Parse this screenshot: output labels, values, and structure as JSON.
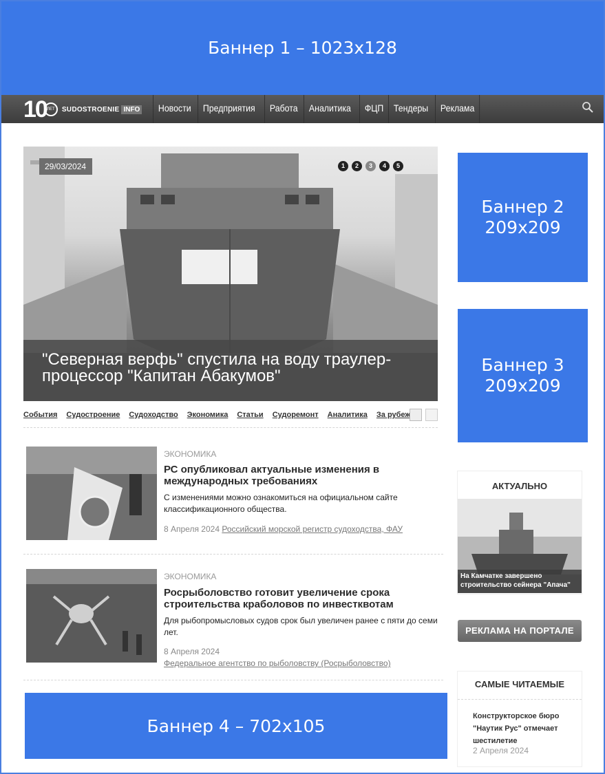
{
  "banners": {
    "b1": "Баннер 1 – 1023x128",
    "b2_line1": "Баннер 2",
    "b2_line2": "209x209",
    "b3_line1": "Баннер 3",
    "b3_line2": "209x209",
    "b4": "Баннер 4 – 702x105"
  },
  "logo": {
    "ten": "10",
    "let": "ЛЕТ",
    "name": "SUDOSTROENIE",
    "info": "INFO"
  },
  "nav": {
    "items": [
      "Новости",
      "Предприятия",
      "Работа",
      "Аналитика",
      "ФЦП",
      "Тендеры",
      "Реклама"
    ],
    "search_icon": "search-icon"
  },
  "hero": {
    "date": "29/03/2024",
    "title": "\"Северная верфь\" спустила на воду траулер-процессор \"Капитан Абакумов\"",
    "slides": [
      "1",
      "2",
      "3",
      "4",
      "5"
    ],
    "active_slide": 3
  },
  "categories": [
    "События",
    "Судостроение",
    "Судоходство",
    "Экономика",
    "Статьи",
    "Судоремонт",
    "Аналитика",
    "За рубежом"
  ],
  "articles": [
    {
      "category": "Экономика",
      "title": "РС опубликовал актуальные изменения в международных требованиях",
      "desc": "С изменениями можно ознакомиться на официальном сайте классификационного общества.",
      "date": "8 Апреля 2024",
      "source": "Российский морской регистр судоходства, ФАУ"
    },
    {
      "category": "Экономика",
      "title": "Росрыболовство готовит увеличение срока строительства краболовов по инвестквотам",
      "desc": "Для рыбопромысловых судов срок был увеличен ранее с пяти до семи лет.",
      "date": "8 Апреля 2024",
      "source": "Федеральное агентство по рыболовству (Росрыболовство)"
    }
  ],
  "sidebar": {
    "aktual_head": "АКТУАЛЬНО",
    "aktual_caption": "На Камчатке завершено строительство сейнера \"Апача\"",
    "ad_button": "РЕКЛАМА НА ПОРТАЛЕ",
    "popular_head": "САМЫЕ ЧИТАЕМЫЕ",
    "popular_title": "Конструкторское бюро \"Наутик Рус\" отмечает шестилетие",
    "popular_date": "2 Апреля 2024"
  }
}
